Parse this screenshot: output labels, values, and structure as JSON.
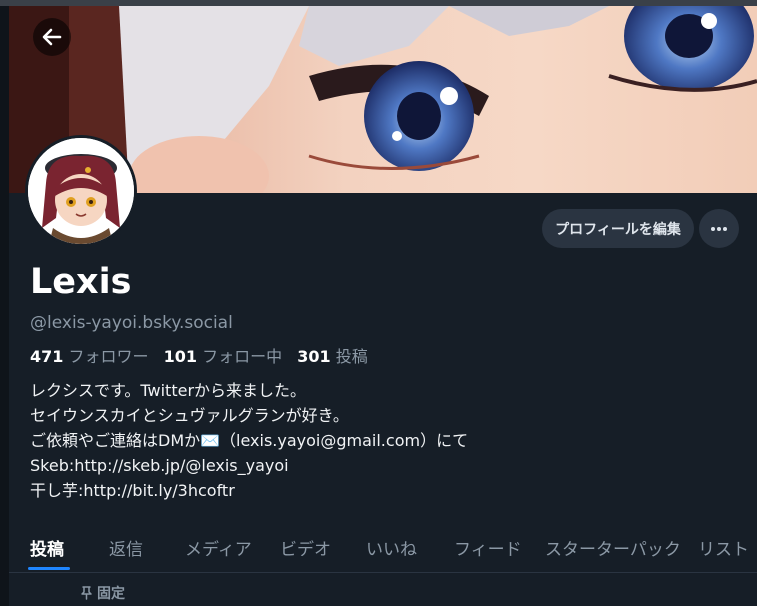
{
  "profile": {
    "display_name": "Lexis",
    "handle": "@lexis-yayoi.bsky.social"
  },
  "stats": {
    "followers_count": "471",
    "followers_label": "フォロワー",
    "following_count": "101",
    "following_label": "フォロー中",
    "posts_count": "301",
    "posts_label": "投稿"
  },
  "bio": {
    "line1": "レクシスです。Twitterから来ました。",
    "line2": "セイウンスカイとシュヴァルグランが好き。",
    "line3": "ご依頼やご連絡はDMか✉️（lexis.yayoi@gmail.com）にて",
    "line4": "Skeb:http://skeb.jp/@lexis_yayoi",
    "line5": "干し芋:http://bit.ly/3hcoftr"
  },
  "actions": {
    "edit_profile_label": "プロフィールを編集",
    "back_icon": "arrow-left-icon",
    "more_icon": "ellipsis-icon"
  },
  "tabs": [
    {
      "label": "投稿"
    },
    {
      "label": "返信"
    },
    {
      "label": "メディア"
    },
    {
      "label": "ビデオ"
    },
    {
      "label": "いいね"
    },
    {
      "label": "フィード"
    },
    {
      "label": "スターターパック"
    },
    {
      "label": "リスト"
    }
  ],
  "pinned": {
    "label": "固定",
    "icon": "pin-icon"
  },
  "colors": {
    "background": "#161e27",
    "accent": "#1f86ff",
    "muted_text": "#8b98a5",
    "button_bg": "#2a3441"
  }
}
